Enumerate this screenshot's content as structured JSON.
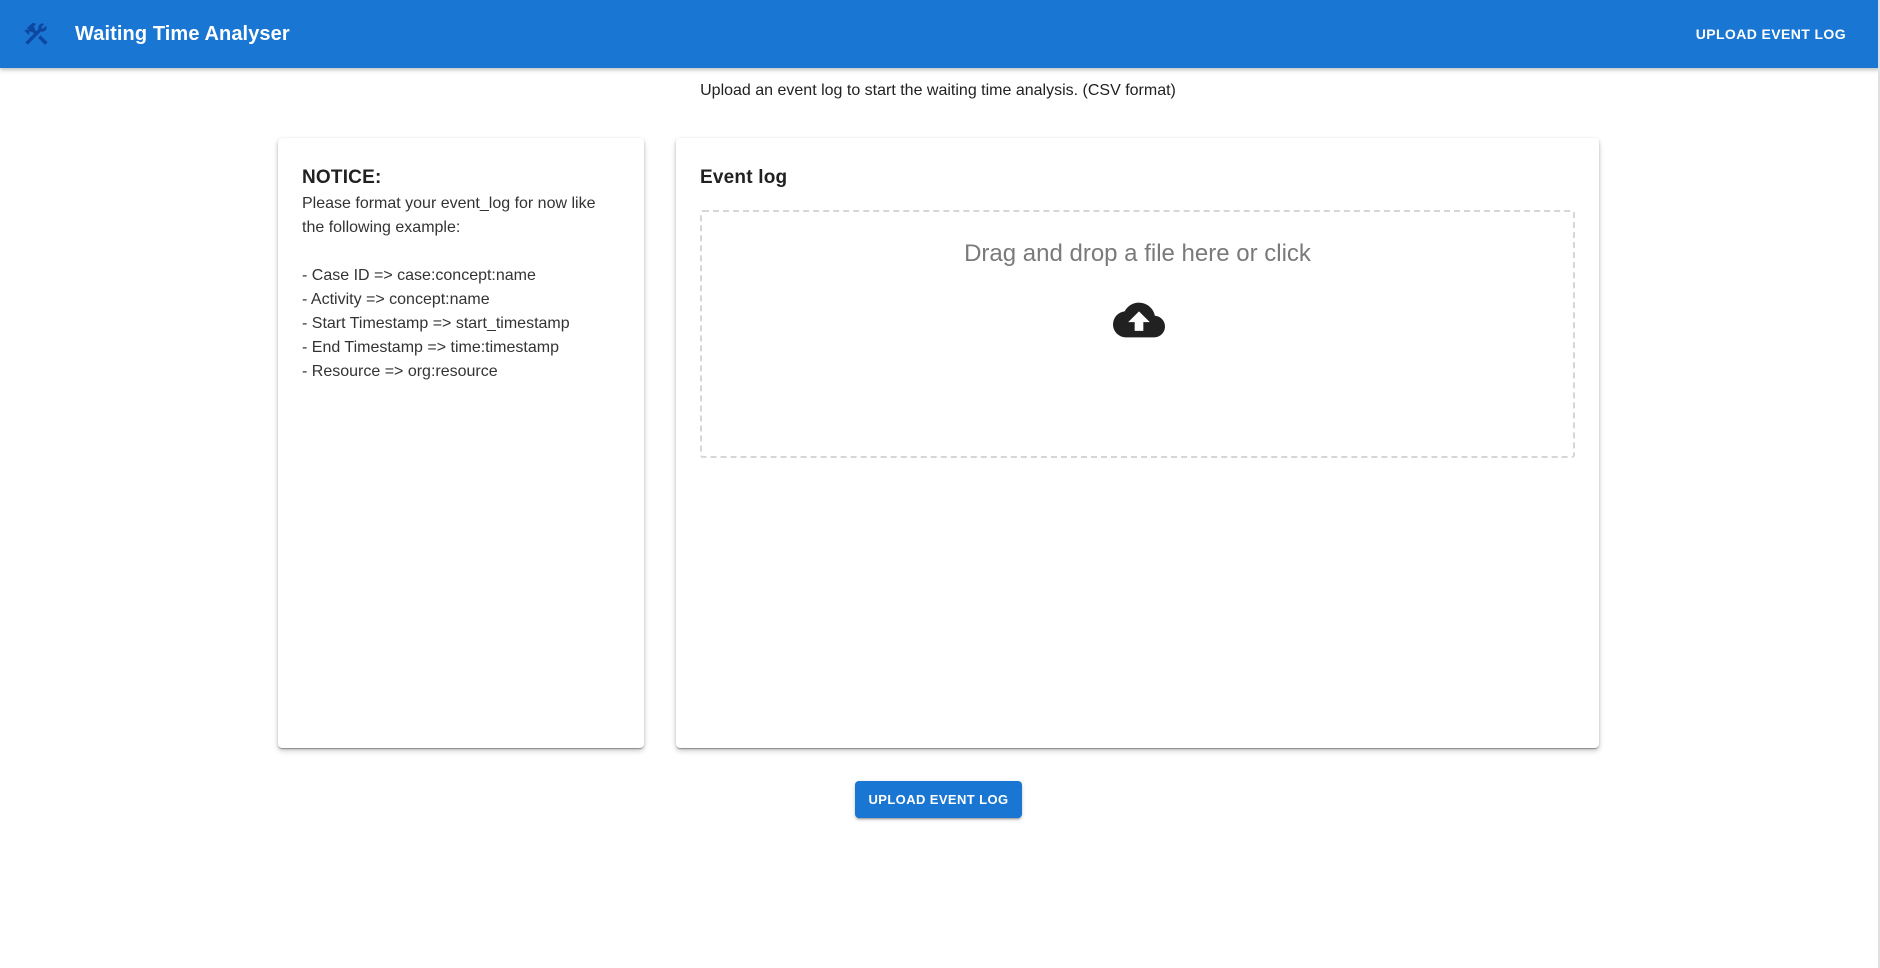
{
  "appbar": {
    "icon": "build-tools-icon",
    "title": "Waiting Time Analyser",
    "upload_button": "UPLOAD EVENT LOG"
  },
  "subtitle": "Upload an event log to start the waiting time analysis. (CSV format)",
  "notice": {
    "title": "NOTICE:",
    "intro": "Please format your event_log for now like the following example:",
    "items": [
      "- Case ID => case:concept:name",
      "- Activity => concept:name",
      "- Start Timestamp => start_timestamp",
      "- End Timestamp => time:timestamp",
      "- Resource => org:resource"
    ]
  },
  "event_log": {
    "title": "Event log",
    "dropzone_text": "Drag and drop a file here or click",
    "dropzone_icon": "cloud-upload-icon"
  },
  "bottom_upload_button": "UPLOAD EVENT LOG",
  "colors": {
    "primary": "#1976d2",
    "dropzone_border": "#d6d6d6",
    "dropzone_text": "#7a7a7a"
  }
}
